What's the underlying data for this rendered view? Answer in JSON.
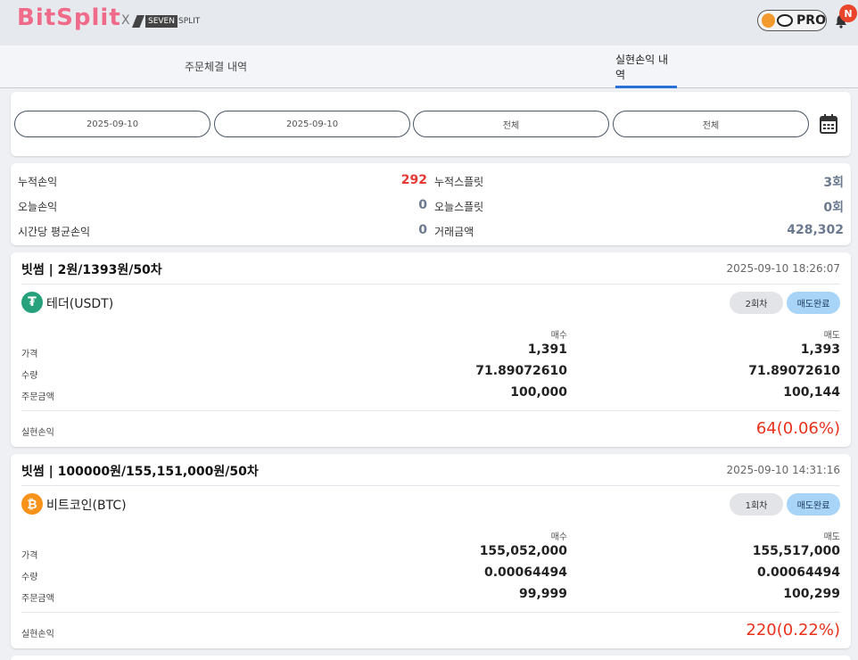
{
  "header": {
    "logo": "BitSplit",
    "x": "X",
    "partner_seven": "SEVEN",
    "partner_split": "SPLIT",
    "pro_label": "PRO",
    "notification_badge": "N"
  },
  "tabs": [
    {
      "label": "주문체결 내역",
      "active": false
    },
    {
      "label": "실현손익 내역",
      "active": true
    }
  ],
  "filters": {
    "start_date": "2025-09-10",
    "end_date": "2025-09-10",
    "filter1": "전체",
    "filter2": "전체"
  },
  "summary": {
    "cum_pnl_label": "누적손익",
    "cum_pnl_value": "292",
    "cum_split_label": "누적스플릿",
    "cum_split_value": "3회",
    "today_pnl_label": "오늘손익",
    "today_pnl_value": "0",
    "today_split_label": "오늘스플릿",
    "today_split_value": "0회",
    "avg_pnl_label": "시간당 평균손익",
    "avg_pnl_value": "0",
    "volume_label": "거래금액",
    "volume_value": "428,302"
  },
  "trades": [
    {
      "title": "빗썸 | 2원/1393원/50차",
      "time": "2025-09-10 18:26:07",
      "coin": "테더(USDT)",
      "round": "2회차",
      "status": "매도완료",
      "buy_header": "매수",
      "sell_header": "매도",
      "price_label": "가격",
      "buy_price": "1,391",
      "sell_price": "1,393",
      "qty_label": "수량",
      "buy_qty": "71.89072610",
      "sell_qty": "71.89072610",
      "amount_label": "주문금액",
      "buy_amount": "100,000",
      "sell_amount": "100,144",
      "pnl_label": "실현손익",
      "pnl_value": "64(0.06%)"
    },
    {
      "title": "빗썸 | 100000원/155,151,000원/50차",
      "time": "2025-09-10 14:31:16",
      "coin": "비트코인(BTC)",
      "round": "1회차",
      "status": "매도완료",
      "buy_header": "매수",
      "sell_header": "매도",
      "price_label": "가격",
      "buy_price": "155,052,000",
      "sell_price": "155,517,000",
      "qty_label": "수량",
      "buy_qty": "0.00064494",
      "sell_qty": "0.00064494",
      "amount_label": "주문금액",
      "buy_amount": "99,999",
      "sell_amount": "100,299",
      "pnl_label": "실현손익",
      "pnl_value": "220(0.22%)"
    }
  ],
  "colors": {
    "accent_blue": "#2b6fd8",
    "loss_red": "#e8321c",
    "usdt_green": "#26a17b",
    "btc_orange": "#f7931a"
  }
}
